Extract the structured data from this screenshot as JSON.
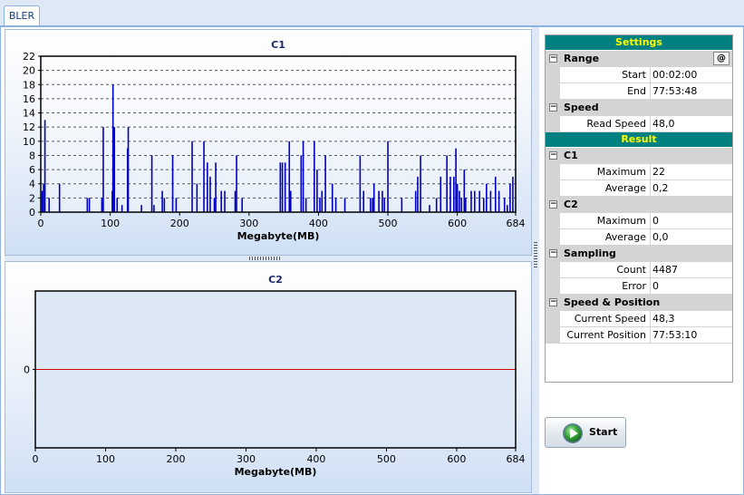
{
  "tabs": [
    {
      "label": "BLER"
    }
  ],
  "charts": [
    {
      "id": "c1",
      "title": "C1",
      "xlabel": "Megabyte(MB)",
      "xticks": [
        0,
        100,
        200,
        300,
        400,
        500,
        600,
        684
      ],
      "yticks": [
        0,
        2,
        4,
        6,
        8,
        10,
        12,
        14,
        16,
        18,
        20,
        22
      ],
      "line_color": "#0000c0"
    },
    {
      "id": "c2",
      "title": "C2",
      "xlabel": "Megabyte(MB)",
      "xticks": [
        0,
        100,
        200,
        300,
        400,
        500,
        600,
        684
      ],
      "yticks": [
        0
      ],
      "line_color": "#d00000"
    }
  ],
  "chart_data": [
    {
      "type": "bar",
      "title": "C1",
      "xlabel": "Megabyte(MB)",
      "ylabel": "",
      "xlim": [
        0,
        684
      ],
      "ylim": [
        0,
        22
      ],
      "grid": true,
      "x": [
        2,
        4,
        6,
        12,
        27,
        67,
        70,
        88,
        90,
        103,
        104,
        106,
        110,
        117,
        125,
        126,
        145,
        160,
        163,
        175,
        178,
        190,
        195,
        218,
        225,
        235,
        240,
        244,
        250,
        252,
        260,
        265,
        280,
        282,
        290,
        345,
        348,
        352,
        358,
        360,
        375,
        378,
        382,
        394,
        398,
        402,
        405,
        410,
        420,
        425,
        438,
        460,
        465,
        475,
        478,
        480,
        487,
        492,
        495,
        500,
        520,
        540,
        543,
        547,
        560,
        570,
        576,
        585,
        590,
        595,
        598,
        600,
        603,
        606,
        610,
        612,
        620,
        625,
        632,
        638,
        642,
        648,
        655,
        660,
        668,
        672,
        676,
        680
      ],
      "values": [
        3,
        4,
        13,
        2,
        4,
        2,
        2,
        2,
        12,
        3,
        18,
        12,
        2,
        1,
        9,
        12,
        1,
        8,
        1,
        3,
        2,
        8,
        2,
        10,
        4,
        10,
        7,
        5,
        2,
        7,
        3,
        3,
        3,
        8,
        2,
        7,
        7,
        7,
        10,
        3,
        8,
        10,
        2,
        10,
        6,
        2,
        3,
        8,
        4,
        2,
        2,
        8,
        3,
        2,
        2,
        4,
        3,
        3,
        2,
        10,
        2,
        3,
        5,
        8,
        1,
        2,
        5,
        8,
        5,
        5,
        9,
        4,
        3,
        2,
        6,
        2,
        3,
        3,
        3,
        2,
        4,
        3,
        5,
        3,
        2,
        1,
        4,
        5
      ]
    },
    {
      "type": "line",
      "title": "C2",
      "xlabel": "Megabyte(MB)",
      "ylabel": "",
      "xlim": [
        0,
        684
      ],
      "ylim": [
        -1,
        1
      ],
      "grid": false,
      "x": [
        0,
        684
      ],
      "values": [
        0,
        0
      ]
    }
  ],
  "settings": {
    "header": "Settings",
    "range": {
      "label": "Range",
      "at_button": "@",
      "start_label": "Start",
      "start_value": "00:02:00",
      "end_label": "End",
      "end_value": "77:53:48"
    },
    "speed": {
      "label": "Speed",
      "read_speed_label": "Read Speed",
      "read_speed_value": "48,0"
    }
  },
  "result": {
    "header": "Result",
    "c1": {
      "label": "C1",
      "max_label": "Maximum",
      "max_value": "22",
      "avg_label": "Average",
      "avg_value": "0,2"
    },
    "c2": {
      "label": "C2",
      "max_label": "Maximum",
      "max_value": "0",
      "avg_label": "Average",
      "avg_value": "0,0"
    },
    "sampling": {
      "label": "Sampling",
      "count_label": "Count",
      "count_value": "4487",
      "error_label": "Error",
      "error_value": "0"
    },
    "speed_position": {
      "label": "Speed & Position",
      "cur_speed_label": "Current Speed",
      "cur_speed_value": "48,3",
      "cur_pos_label": "Current Position",
      "cur_pos_value": "77:53:10"
    }
  },
  "start_button": {
    "label": "Start",
    "icon": "play-icon"
  },
  "toggle_symbol": "−"
}
